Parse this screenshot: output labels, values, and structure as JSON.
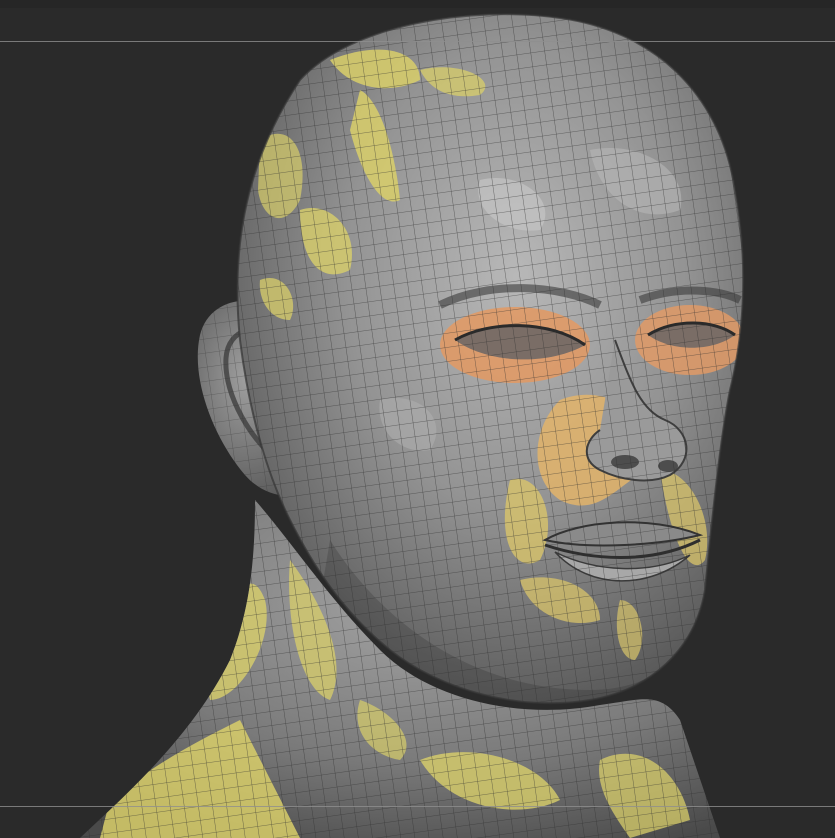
{
  "viewport": {
    "background": "#2a2a2a",
    "guide_color": "#8f8f8f"
  },
  "model": {
    "subject": "sculpted-male-head-bust",
    "base_color": "#8c8c8c",
    "mask_color": "#d9cf6a",
    "eye_mask_color": "#e0a06a",
    "wire_color": "#2f2f2f",
    "polygroup_display": true,
    "wireframe_display": true
  }
}
